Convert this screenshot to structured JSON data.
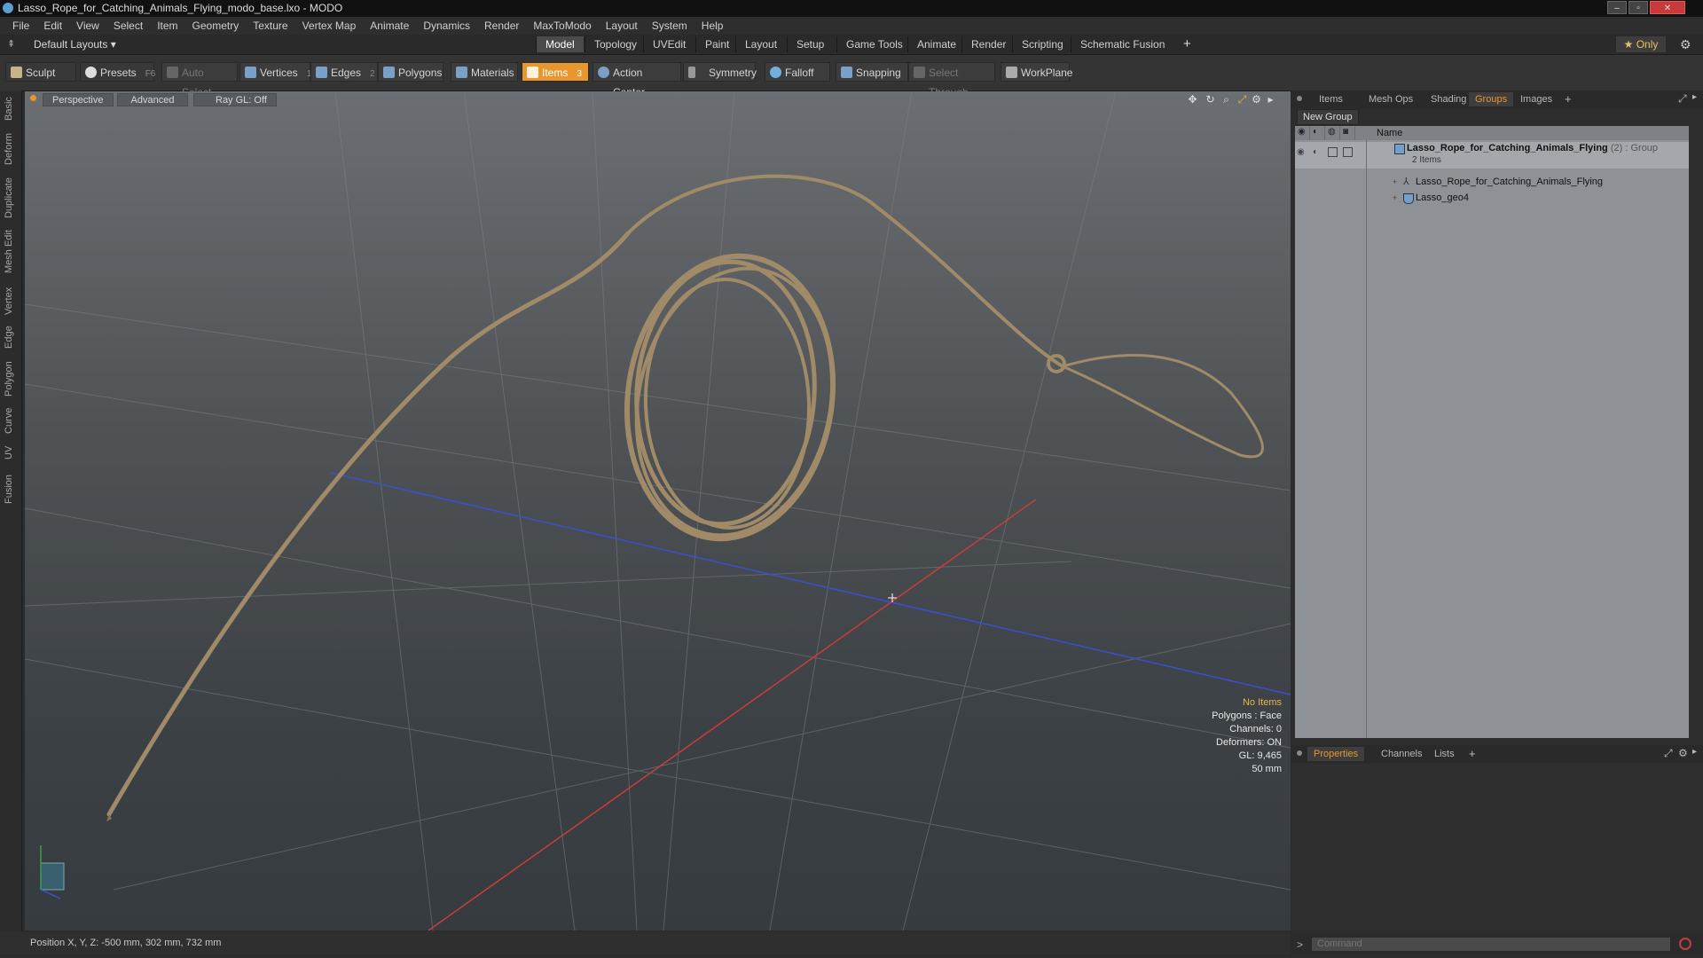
{
  "window": {
    "title": "Lasso_Rope_for_Catching_Animals_Flying_modo_base.lxo - MODO",
    "minimize": "–",
    "maximize": "▫",
    "close": "✕"
  },
  "menubar": {
    "items": [
      "File",
      "Edit",
      "View",
      "Select",
      "Item",
      "Geometry",
      "Texture",
      "Vertex Map",
      "Animate",
      "Dynamics",
      "Render",
      "MaxToModo",
      "Layout",
      "System",
      "Help"
    ]
  },
  "layoutbar": {
    "layouts_label": "Default Layouts ▾",
    "tabs": [
      "Model",
      "Topology",
      "UVEdit",
      "Paint",
      "Layout",
      "Setup",
      "Game Tools",
      "Animate",
      "Render",
      "Scripting",
      "Schematic Fusion"
    ],
    "active_tab": "Model",
    "add_tab": "+",
    "only_label": "★ Only",
    "settings_icon": "gear-icon"
  },
  "toolbar": {
    "sculpt": "Sculpt",
    "presets": "Presets",
    "presets_key": "F6",
    "auto_select": "Auto Select",
    "vertices": "Vertices",
    "vertices_count": "1",
    "edges": "Edges",
    "edges_count": "2",
    "polygons": "Polygons",
    "materials": "Materials",
    "items": "Items",
    "items_count": "3",
    "action_center": "Action Center",
    "symmetry": "Symmetry",
    "falloff": "Falloff",
    "snapping": "Snapping",
    "select_through": "Select Through",
    "workplane": "WorkPlane"
  },
  "left_tabs": [
    "Basic",
    "Deform",
    "Duplicate",
    "Mesh Edit",
    "Vertex",
    "Edge",
    "Polygon",
    "Curve",
    "UV",
    "Fusion"
  ],
  "viewport": {
    "view_mode": "Perspective",
    "shading": "Advanced",
    "raygl": "Ray GL: Off",
    "hud": {
      "selection": "No Items",
      "polygons": "Polygons : Face",
      "channels": "Channels: 0",
      "deformers": "Deformers: ON",
      "gl": "GL: 9,465",
      "scale": "50 mm"
    },
    "colors": {
      "rope": "#a08a68",
      "x_axis": "#cc3b3b",
      "z_axis": "#3b4fd0",
      "hud_highlight": "#e8b84a"
    }
  },
  "statusbar": {
    "position": "Position X, Y, Z:  -500 mm, 302 mm, 732 mm"
  },
  "right_panel": {
    "tabs": [
      "Items",
      "Mesh Ops",
      "Shading",
      "Groups",
      "Images"
    ],
    "active_tab": "Groups",
    "add_tab": "+",
    "new_group": "New Group",
    "column_name": "Name",
    "group": {
      "name": "Lasso_Rope_for_Catching_Animals_Flying",
      "count": "(2)",
      "type": ": Group",
      "subtitle": "2 Items"
    },
    "children": [
      {
        "name": "Lasso_Rope_for_Catching_Animals_Flying",
        "icon": "locator-icon"
      },
      {
        "name": "Lasso_geo4",
        "icon": "mesh-icon"
      }
    ],
    "bottom_tabs": [
      "Properties",
      "Channels",
      "Lists"
    ],
    "bottom_active": "Properties",
    "command_placeholder": "Command",
    "command_prompt": ">"
  }
}
